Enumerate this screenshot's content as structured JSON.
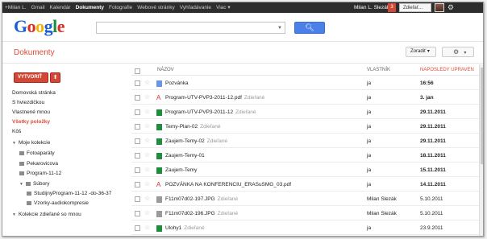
{
  "topbar": {
    "nav": [
      "+Milan L.",
      "Gmail",
      "Kalendár",
      "Dokumenty",
      "Fotografie",
      "Webové stránky",
      "Vyhľadávanie",
      "Viac ▾"
    ],
    "active_index": 3,
    "user": "Milan L. Slezák",
    "notifications": "3",
    "share": "Zdieľať..."
  },
  "logo": {
    "letters": [
      "G",
      "o",
      "o",
      "g",
      "l",
      "e"
    ]
  },
  "header": {
    "title": "Dokumenty"
  },
  "toolbar": {
    "sort": "Zoradiť ▾",
    "settings_arrow": "▾"
  },
  "sidebar": {
    "create": "VYTVORIŤ",
    "upload_icon": "upload-icon",
    "items": [
      {
        "label": "Domovská stránka",
        "kind": "link"
      },
      {
        "label": "S hviezdičkou",
        "kind": "link"
      },
      {
        "label": "Vlastnené mnou",
        "kind": "link"
      },
      {
        "label": "Všetky položky",
        "kind": "active"
      },
      {
        "label": "Kôš",
        "kind": "link"
      },
      {
        "label": "Moje kolekcie",
        "kind": "tree"
      },
      {
        "label": "Fotoaparáty",
        "kind": "folder",
        "indent": 1
      },
      {
        "label": "Pekarovicova",
        "kind": "folder",
        "indent": 1
      },
      {
        "label": "Program-11-12",
        "kind": "folder",
        "indent": 1
      },
      {
        "label": "Súbory",
        "kind": "tree-folder",
        "indent": 1
      },
      {
        "label": "StudijnyProgram-11-12 -do-36-37",
        "kind": "folder",
        "indent": 2
      },
      {
        "label": "Vzorky-audiokompresie",
        "kind": "folder",
        "indent": 2
      },
      {
        "label": "Kolekcie zdieľané so mnou",
        "kind": "tree"
      }
    ]
  },
  "table": {
    "headers": {
      "name": "NÁZOV",
      "owner": "VLASTNÍK",
      "modified": "NAPOSLEDY UPRAVEN"
    },
    "rows": [
      {
        "icon": "doc",
        "name": "Pozvánka",
        "shared": "",
        "owner": "ja",
        "mod": "16:56",
        "mod_unit": "ja",
        "bold": true
      },
      {
        "icon": "pdf",
        "name": "Program-UTV-PVP3-2011-12.pdf",
        "shared": "Zdieľané",
        "owner": "ja",
        "mod": "3. jan",
        "mod_unit": "ja",
        "bold": true
      },
      {
        "icon": "sheet",
        "name": "Program-UTV-PVP3-2011-12",
        "shared": "Zdieľané",
        "owner": "ja",
        "mod": "29.11.2011",
        "mod_unit": "ja",
        "bold": true
      },
      {
        "icon": "sheet",
        "name": "Temy-Plan-02",
        "shared": "Zdieľané",
        "owner": "ja",
        "mod": "29.11.2011",
        "mod_unit": "ja",
        "bold": true
      },
      {
        "icon": "sheet",
        "name": "Zaujem-Temy-02",
        "shared": "Zdieľané",
        "owner": "ja",
        "mod": "29.11.2011",
        "mod_unit": "ja",
        "bold": true
      },
      {
        "icon": "sheet",
        "name": "Zaujem-Temy-01",
        "shared": "",
        "owner": "ja",
        "mod": "18.11.2011",
        "mod_unit": "ja",
        "bold": true
      },
      {
        "icon": "sheet",
        "name": "Zaujem-Temy",
        "shared": "",
        "owner": "ja",
        "mod": "15.11.2011",
        "mod_unit": "ja",
        "bold": true
      },
      {
        "icon": "pdf",
        "name": "POZVÁNKA NA KONFERENCIU_ERASuSMG_03.pdf",
        "shared": "",
        "owner": "ja",
        "mod": "14.11.2011",
        "mod_unit": "ja",
        "bold": true
      },
      {
        "icon": "img",
        "name": "F11m07d02-197.JPG",
        "shared": "Zdieľané",
        "owner": "Milan Slezák",
        "mod": "5.10.2011",
        "mod_unit": "Milan Slezák",
        "bold": false
      },
      {
        "icon": "img",
        "name": "F11m07d02-196.JPG",
        "shared": "Zdieľané",
        "owner": "Milan Slezák",
        "mod": "5.10.2011",
        "mod_unit": "Milan Slezák",
        "bold": false
      },
      {
        "icon": "sheet",
        "name": "Ulohy1",
        "shared": "Zdieľané",
        "owner": "ja",
        "mod": "23.9.2011",
        "mod_unit": "ja",
        "bold": false
      }
    ]
  }
}
